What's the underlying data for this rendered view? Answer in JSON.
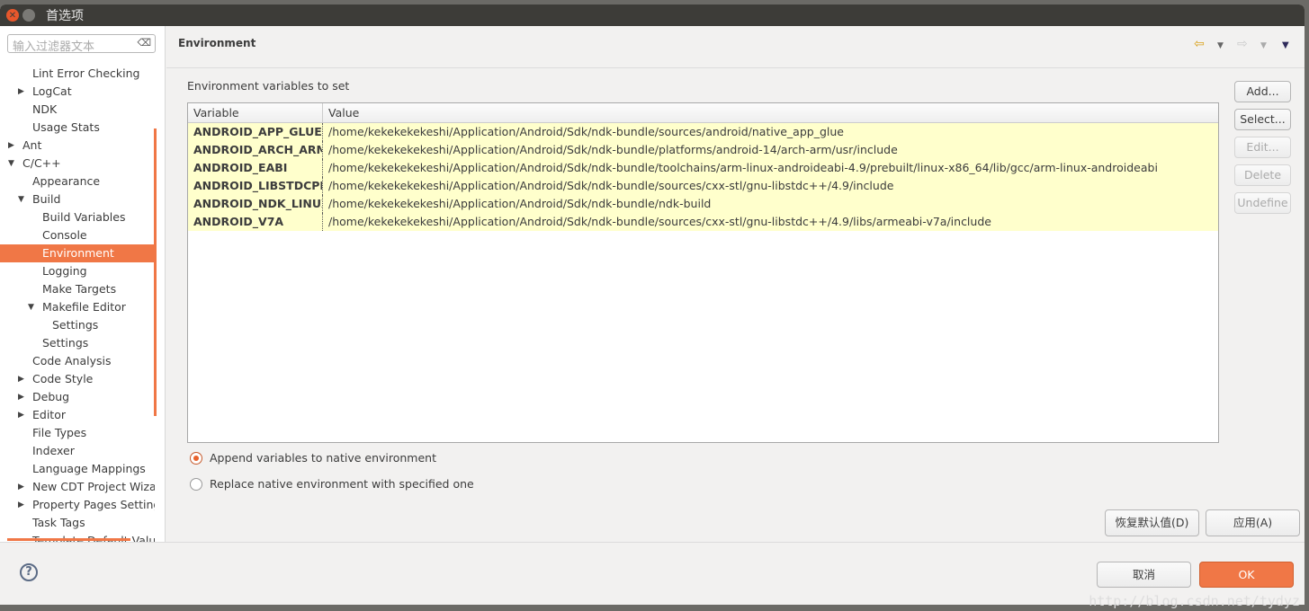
{
  "window": {
    "title": "首选项"
  },
  "sidebar": {
    "filter_placeholder": "输入过滤器文本",
    "items": [
      {
        "label": "Lint Error Checking",
        "indent": 1,
        "tw": ""
      },
      {
        "label": "LogCat",
        "indent": 1,
        "tw": "collapsed"
      },
      {
        "label": "NDK",
        "indent": 1,
        "tw": ""
      },
      {
        "label": "Usage Stats",
        "indent": 1,
        "tw": ""
      },
      {
        "label": "Ant",
        "indent": 0,
        "tw": "collapsed"
      },
      {
        "label": "C/C++",
        "indent": 0,
        "tw": "expanded"
      },
      {
        "label": "Appearance",
        "indent": 1,
        "tw": ""
      },
      {
        "label": "Build",
        "indent": 1,
        "tw": "expanded"
      },
      {
        "label": "Build Variables",
        "indent": 2,
        "tw": ""
      },
      {
        "label": "Console",
        "indent": 2,
        "tw": ""
      },
      {
        "label": "Environment",
        "indent": 2,
        "tw": "",
        "selected": true
      },
      {
        "label": "Logging",
        "indent": 2,
        "tw": ""
      },
      {
        "label": "Make Targets",
        "indent": 2,
        "tw": ""
      },
      {
        "label": "Makefile Editor",
        "indent": 2,
        "tw": "expanded"
      },
      {
        "label": "Settings",
        "indent": 3,
        "tw": ""
      },
      {
        "label": "Settings",
        "indent": 2,
        "tw": ""
      },
      {
        "label": "Code Analysis",
        "indent": 1,
        "tw": ""
      },
      {
        "label": "Code Style",
        "indent": 1,
        "tw": "collapsed"
      },
      {
        "label": "Debug",
        "indent": 1,
        "tw": "collapsed"
      },
      {
        "label": "Editor",
        "indent": 1,
        "tw": "collapsed"
      },
      {
        "label": "File Types",
        "indent": 1,
        "tw": ""
      },
      {
        "label": "Indexer",
        "indent": 1,
        "tw": ""
      },
      {
        "label": "Language Mappings",
        "indent": 1,
        "tw": ""
      },
      {
        "label": "New CDT Project Wizard",
        "indent": 1,
        "tw": "collapsed"
      },
      {
        "label": "Property Pages Settings",
        "indent": 1,
        "tw": "collapsed"
      },
      {
        "label": "Task Tags",
        "indent": 1,
        "tw": ""
      },
      {
        "label": "Template Default Values",
        "indent": 1,
        "tw": ""
      }
    ]
  },
  "page": {
    "title": "Environment",
    "table_label": "Environment variables to set",
    "columns": [
      "Variable",
      "Value"
    ],
    "rows": [
      [
        "ANDROID_APP_GLUE",
        "/home/kekekekekeshi/Application/Android/Sdk/ndk-bundle/sources/android/native_app_glue"
      ],
      [
        "ANDROID_ARCH_ARM",
        "/home/kekekekekeshi/Application/Android/Sdk/ndk-bundle/platforms/android-14/arch-arm/usr/include"
      ],
      [
        "ANDROID_EABI",
        "/home/kekekekekeshi/Application/Android/Sdk/ndk-bundle/toolchains/arm-linux-androideabi-4.9/prebuilt/linux-x86_64/lib/gcc/arm-linux-androideabi"
      ],
      [
        "ANDROID_LIBSTDCPP",
        "/home/kekekekekeshi/Application/Android/Sdk/ndk-bundle/sources/cxx-stl/gnu-libstdc++/4.9/include"
      ],
      [
        "ANDROID_NDK_LINUX",
        "/home/kekekekekeshi/Application/Android/Sdk/ndk-bundle/ndk-build"
      ],
      [
        "ANDROID_V7A",
        "/home/kekekekekeshi/Application/Android/Sdk/ndk-bundle/sources/cxx-stl/gnu-libstdc++/4.9/libs/armeabi-v7a/include"
      ]
    ],
    "buttons": {
      "add": "Add...",
      "select": "Select...",
      "edit": "Edit...",
      "delete": "Delete",
      "undefine": "Undefine"
    },
    "radio_append": "Append variables to native environment",
    "radio_replace": "Replace native environment with specified one",
    "selected_radio": "append",
    "restore": "恢复默认值(D)",
    "apply": "应用(A)"
  },
  "footer": {
    "cancel": "取消",
    "ok": "OK",
    "help": "?"
  },
  "watermark": "http://blog.csdn.net/tydyz",
  "colors": {
    "accent": "#f07746",
    "row_highlight": "#ffffcc"
  }
}
